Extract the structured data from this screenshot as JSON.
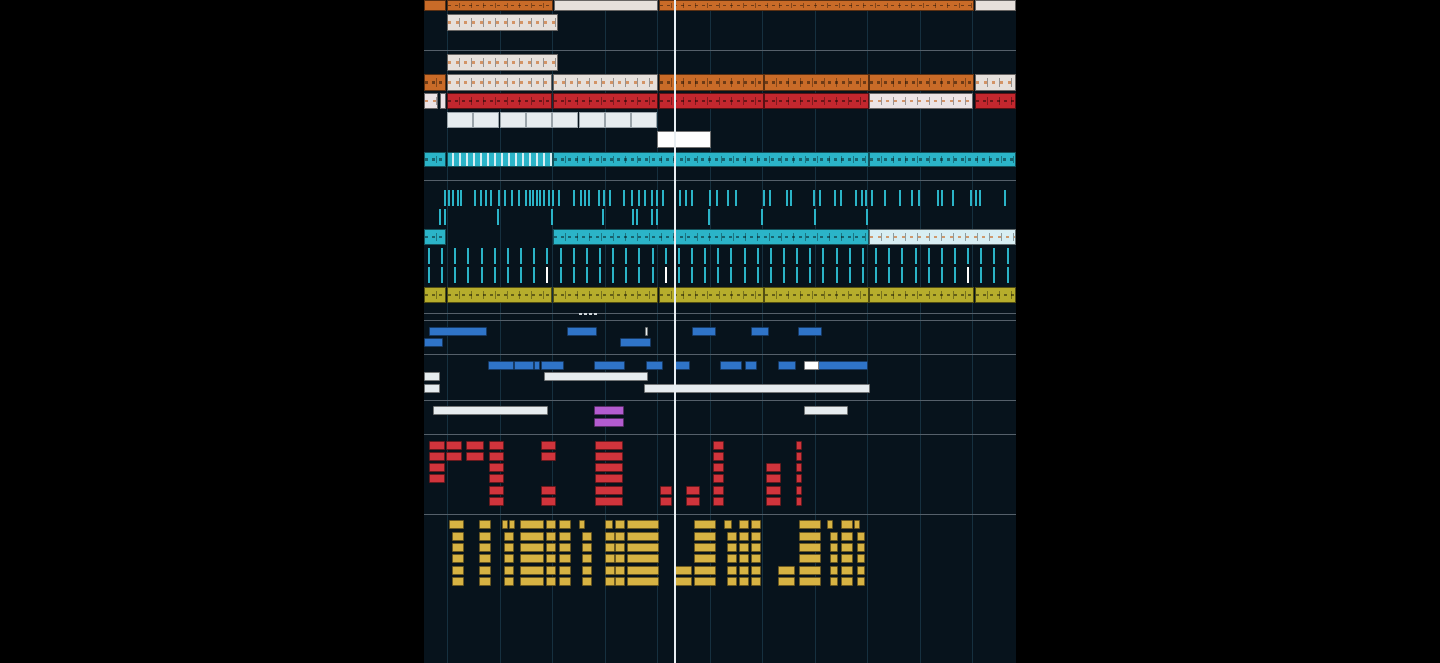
{
  "app": {
    "view": "arrangement-timeline",
    "tracks_visible": 12
  },
  "colors": {
    "background": "#07131c",
    "orange": "#c96b28",
    "orange_pale": "#e6e0db",
    "red": "#c3272e",
    "red_pale": "#ece3e5",
    "cyan": "#2bb4c8",
    "cyan_pale": "#d8eef3",
    "olive": "#b6ad2c",
    "blue": "#2f74c8",
    "white_clip": "#e6ecef",
    "purple": "#b35cd0",
    "midi_red": "#d0343c",
    "midi_gold": "#d7b343",
    "playhead": "#e8eef2"
  },
  "tracks": [
    {
      "name": "orange-audio",
      "color": "orange"
    },
    {
      "name": "red-audio",
      "color": "red"
    },
    {
      "name": "white-slices",
      "color": "white_clip"
    },
    {
      "name": "cyan-audio",
      "color": "cyan"
    },
    {
      "name": "cyan-hits",
      "color": "cyan"
    },
    {
      "name": "cyan-loop",
      "color": "cyan"
    },
    {
      "name": "olive-automation",
      "color": "olive"
    },
    {
      "name": "blue-midi",
      "color": "blue"
    },
    {
      "name": "white-midi",
      "color": "white_clip"
    },
    {
      "name": "purple-midi",
      "color": "purple"
    },
    {
      "name": "red-drum-midi",
      "color": "midi_red"
    },
    {
      "name": "gold-drum-midi",
      "color": "midi_gold"
    }
  ]
}
